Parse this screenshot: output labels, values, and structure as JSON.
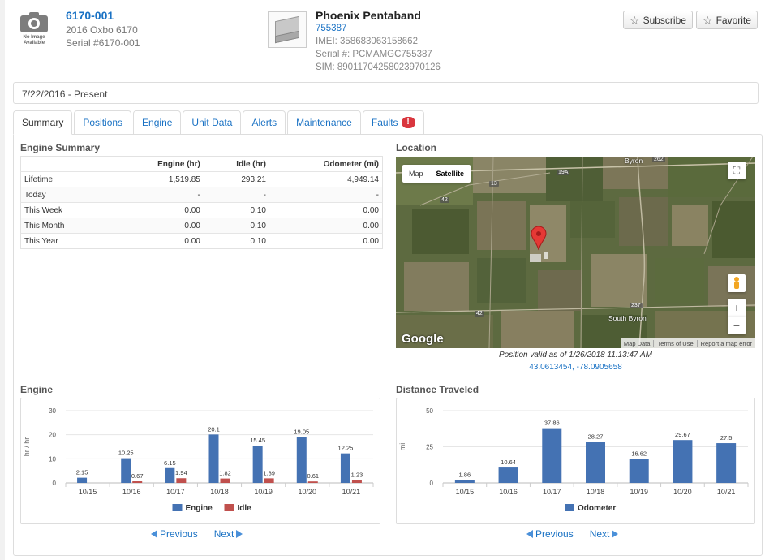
{
  "asset": {
    "id": "6170-001",
    "model": "2016 Oxbo 6170",
    "serial": "Serial #6170-001",
    "no_image_line1": "No Image",
    "no_image_line2": "Available"
  },
  "device": {
    "name": "Phoenix Pentaband",
    "number": "755387",
    "imei": "IMEI: 358683063158662",
    "serial": "Serial #: PCMAMGC755387",
    "sim": "SIM: 89011704258023970126"
  },
  "actions": {
    "subscribe": "Subscribe",
    "favorite": "Favorite"
  },
  "date_range": "7/22/2016 - Present",
  "tabs": [
    {
      "label": "Summary",
      "active": true
    },
    {
      "label": "Positions"
    },
    {
      "label": "Engine"
    },
    {
      "label": "Unit Data"
    },
    {
      "label": "Alerts"
    },
    {
      "label": "Maintenance"
    },
    {
      "label": "Faults",
      "badge": "!"
    }
  ],
  "engine_summary": {
    "title": "Engine Summary",
    "columns": [
      "",
      "Engine (hr)",
      "Idle (hr)",
      "Odometer (mi)"
    ],
    "rows": [
      [
        "Lifetime",
        "1,519.85",
        "293.21",
        "4,949.14"
      ],
      [
        "Today",
        "-",
        "-",
        "-"
      ],
      [
        "This Week",
        "0.00",
        "0.10",
        "0.00"
      ],
      [
        "This Month",
        "0.00",
        "0.10",
        "0.00"
      ],
      [
        "This Year",
        "0.00",
        "0.10",
        "0.00"
      ]
    ]
  },
  "location": {
    "title": "Location",
    "map_type_options": [
      "Map",
      "Satellite"
    ],
    "map_type_selected": "Satellite",
    "place_labels": [
      "Byron",
      "South Byron"
    ],
    "road_labels": [
      "262",
      "19A",
      "13",
      "42",
      "42",
      "237"
    ],
    "attribution": "Google",
    "footer_links": [
      "Map Data",
      "Terms of Use",
      "Report a map error"
    ],
    "position_valid": "Position valid as of 1/26/2018 11:13:47 AM",
    "coordinates": "43.0613454, -78.0905658"
  },
  "engine_chart": {
    "title": "Engine",
    "chart_data": {
      "type": "bar",
      "categories": [
        "10/15",
        "10/16",
        "10/17",
        "10/18",
        "10/19",
        "10/20",
        "10/21"
      ],
      "series": [
        {
          "name": "Engine",
          "values": [
            2.15,
            10.25,
            6.15,
            20.1,
            15.45,
            19.05,
            12.25
          ],
          "labels": [
            "2.15",
            "10.25",
            "6.15",
            "20.1",
            "15.45",
            "19.05",
            "12.25"
          ],
          "color": "#4472b3"
        },
        {
          "name": "Idle",
          "values": [
            0,
            0.67,
            1.94,
            1.82,
            1.89,
            0.61,
            1.23
          ],
          "labels": [
            "",
            "0.67",
            "1.94",
            "1.82",
            "1.89",
            "0.61",
            "1.23"
          ],
          "color": "#c0504d"
        }
      ],
      "ylabel": "hr / hr",
      "yticks": [
        "0",
        "10",
        "20",
        "30"
      ],
      "ylim": [
        0,
        30
      ],
      "legend": "bottom"
    }
  },
  "distance_chart": {
    "title": "Distance Traveled",
    "chart_data": {
      "type": "bar",
      "categories": [
        "10/15",
        "10/16",
        "10/17",
        "10/18",
        "10/19",
        "10/20",
        "10/21"
      ],
      "series": [
        {
          "name": "Odometer",
          "values": [
            1.86,
            10.64,
            37.86,
            28.27,
            16.62,
            29.67,
            27.5
          ],
          "labels": [
            "1.86",
            "10.64",
            "37.86",
            "28.27",
            "16.62",
            "29.67",
            "27.5"
          ],
          "color": "#4472b3"
        }
      ],
      "ylabel": "mi",
      "yticks": [
        "0",
        "25",
        "50"
      ],
      "ylim": [
        0,
        50
      ],
      "legend": "bottom"
    }
  },
  "pager": {
    "previous": "Previous",
    "next": "Next"
  }
}
